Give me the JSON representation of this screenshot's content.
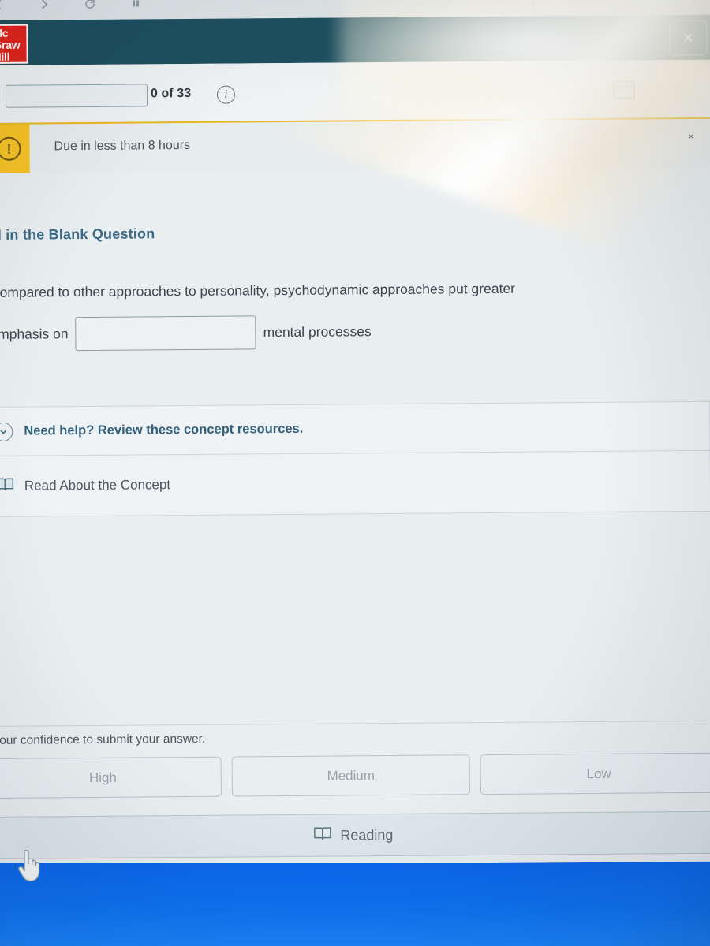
{
  "browser": {
    "nav_icons": [
      "back-icon",
      "forward-icon",
      "reload-icon",
      "pause-icon"
    ]
  },
  "app_header": {
    "logo_line1": "Mc",
    "logo_line2": "Graw",
    "logo_line3": "Hill",
    "close_label": "×",
    "bg_color": "#1d4f5e"
  },
  "progress": {
    "count_label": "0 of 33",
    "info_label": "i",
    "calendar_icon": "calendar-icon"
  },
  "alert": {
    "icon_label": "!",
    "message": "Due in less than 8 hours",
    "close_label": "×",
    "accent_color": "#f7c325"
  },
  "question": {
    "type_label": "ill in the Blank Question",
    "line1": "Compared to other approaches to personality, psychodynamic approaches put greater",
    "line2_prefix": "emphasis on",
    "line2_suffix": "mental processes",
    "answer_value": "",
    "answer_placeholder": ""
  },
  "resources": {
    "header_label": "Need help? Review these concept resources.",
    "items": [
      {
        "label": "Read About the Concept",
        "icon": "book-icon"
      }
    ]
  },
  "confidence": {
    "prompt": "your confidence to submit your answer.",
    "options": [
      {
        "label": "High"
      },
      {
        "label": "Medium"
      },
      {
        "label": "Low"
      }
    ]
  },
  "reading_bar": {
    "label": "Reading",
    "icon": "book-icon"
  },
  "desktop": {
    "color": "#0e72f2"
  }
}
